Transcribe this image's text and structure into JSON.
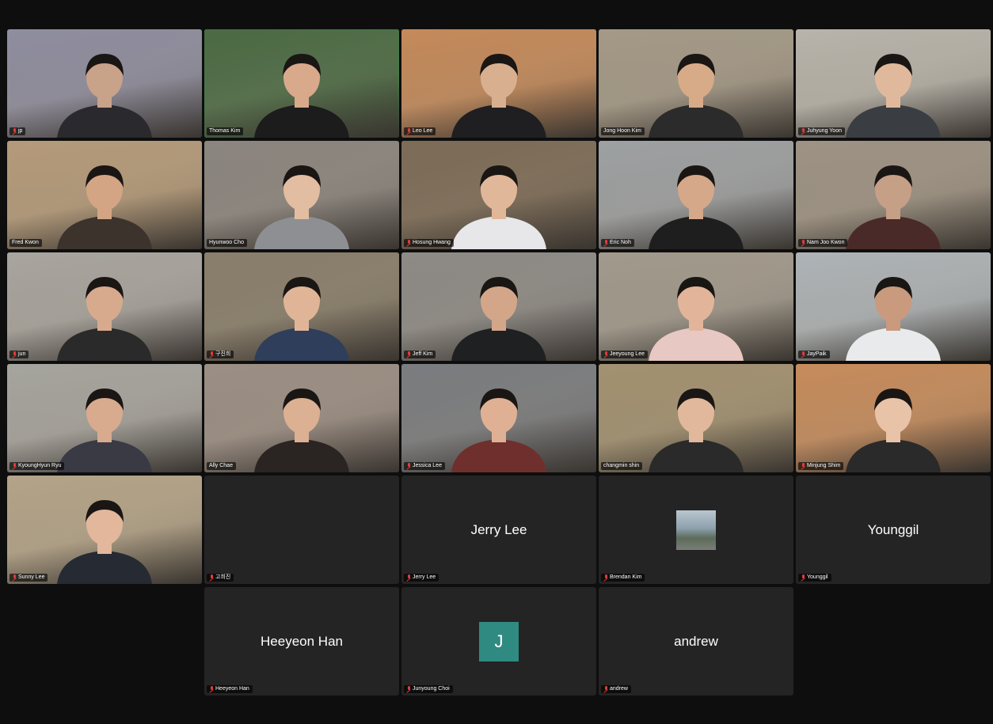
{
  "colors": {
    "background": "#0e0e0e",
    "tile": "#242424",
    "active_speaker_border": "#2fbf5a",
    "muted_mic": "#e23b3b",
    "avatar_initial_bg": "#2f8a82"
  },
  "participants": [
    {
      "name": "jp",
      "type": "video",
      "muted": true,
      "bg": "#8f8ea0",
      "skin": "#c9a28a",
      "shirt": "#2a2a2e"
    },
    {
      "name": "Thomas Kim",
      "type": "video",
      "muted": false,
      "speaking": true,
      "bg": "#4b6b44",
      "skin": "#d8a98b",
      "shirt": "#1c1c1c"
    },
    {
      "name": "Leo Lee",
      "type": "video",
      "muted": true,
      "bg": "#c58a5a",
      "skin": "#d9b08f",
      "shirt": "#1f1f22"
    },
    {
      "name": "Jong Hoon Kim",
      "type": "video",
      "muted": false,
      "bg": "#a59a88",
      "skin": "#d7aa88",
      "shirt": "#2b2b2b"
    },
    {
      "name": "Juhyung Yoon",
      "type": "video",
      "muted": true,
      "bg": "#b8b4ab",
      "skin": "#e0b99c",
      "shirt": "#3a3d42"
    },
    {
      "name": "Fred Kwon",
      "type": "video",
      "muted": false,
      "bg": "#b59b7a",
      "skin": "#d3a584",
      "shirt": "#3b332c"
    },
    {
      "name": "Hyunwoo Cho",
      "type": "video",
      "muted": false,
      "bg": "#8c8680",
      "skin": "#e3bda1",
      "shirt": "#8d8f93"
    },
    {
      "name": "Hosung Hwang",
      "type": "video",
      "muted": true,
      "bg": "#7d6c57",
      "skin": "#e1b79a",
      "shirt": "#e7e7e9"
    },
    {
      "name": "Eric Noh",
      "type": "video",
      "muted": true,
      "bg": "#9ea1a3",
      "skin": "#d5a889",
      "shirt": "#1e1e1e"
    },
    {
      "name": "Nam Joo Kwon",
      "type": "video",
      "muted": true,
      "bg": "#9e9384",
      "skin": "#c69f87",
      "shirt": "#4a2a28"
    },
    {
      "name": "jun",
      "type": "video",
      "muted": true,
      "bg": "#a9a59f",
      "skin": "#d7aa8e",
      "shirt": "#2a2a2a"
    },
    {
      "name": "구진희",
      "type": "video",
      "muted": true,
      "bg": "#8a7f6c",
      "skin": "#e0b597",
      "shirt": "#2f3e5a"
    },
    {
      "name": "Jeff Kim",
      "type": "video",
      "muted": true,
      "bg": "#8e8b87",
      "skin": "#d3a68a",
      "shirt": "#1f2021"
    },
    {
      "name": "Jeeyoung Lee",
      "type": "video",
      "muted": true,
      "bg": "#a29a8d",
      "skin": "#e2b59a",
      "shirt": "#e8c8c2"
    },
    {
      "name": "JayPaik",
      "type": "video",
      "muted": true,
      "bg": "#aeb4b7",
      "skin": "#c99a7d",
      "shirt": "#e9eaec"
    },
    {
      "name": "KyoungHyun Ryu",
      "type": "video",
      "muted": true,
      "bg": "#a7a59f",
      "skin": "#d8aa8e",
      "shirt": "#3a3a44"
    },
    {
      "name": "Ally Chae",
      "type": "video",
      "muted": false,
      "bg": "#9c8f85",
      "skin": "#dcb093",
      "shirt": "#2a2422"
    },
    {
      "name": "Jessica Lee",
      "type": "video",
      "muted": true,
      "bg": "#7b7d80",
      "skin": "#e0b095",
      "shirt": "#6f2f2c"
    },
    {
      "name": "changmin shin",
      "type": "video",
      "muted": false,
      "bg": "#a39271",
      "skin": "#e1b89b",
      "shirt": "#2a2a2a"
    },
    {
      "name": "Minjung Shim",
      "type": "video",
      "muted": true,
      "bg": "#c78c5c",
      "skin": "#e9c3a7",
      "shirt": "#2a2a2a"
    },
    {
      "name": "Sunny Lee",
      "type": "video",
      "muted": true,
      "bg": "#b4a489",
      "skin": "#e2b79c",
      "shirt": "#262a33"
    },
    {
      "name": "고희진",
      "type": "blank",
      "muted": true
    },
    {
      "name": "Jerry Lee",
      "type": "text",
      "display": "Jerry Lee",
      "muted": true
    },
    {
      "name": "Brendan Kim",
      "type": "photo",
      "muted": true
    },
    {
      "name": "Younggil",
      "type": "text",
      "display": "Younggil",
      "muted": true
    },
    {
      "name": "Heeyeon Han",
      "type": "text",
      "display": "Heeyeon Han",
      "muted": true
    },
    {
      "name": "Junyoung Choi",
      "type": "initial",
      "initial": "J",
      "muted": true
    },
    {
      "name": "andrew",
      "type": "text",
      "display": "andrew",
      "muted": true
    }
  ]
}
